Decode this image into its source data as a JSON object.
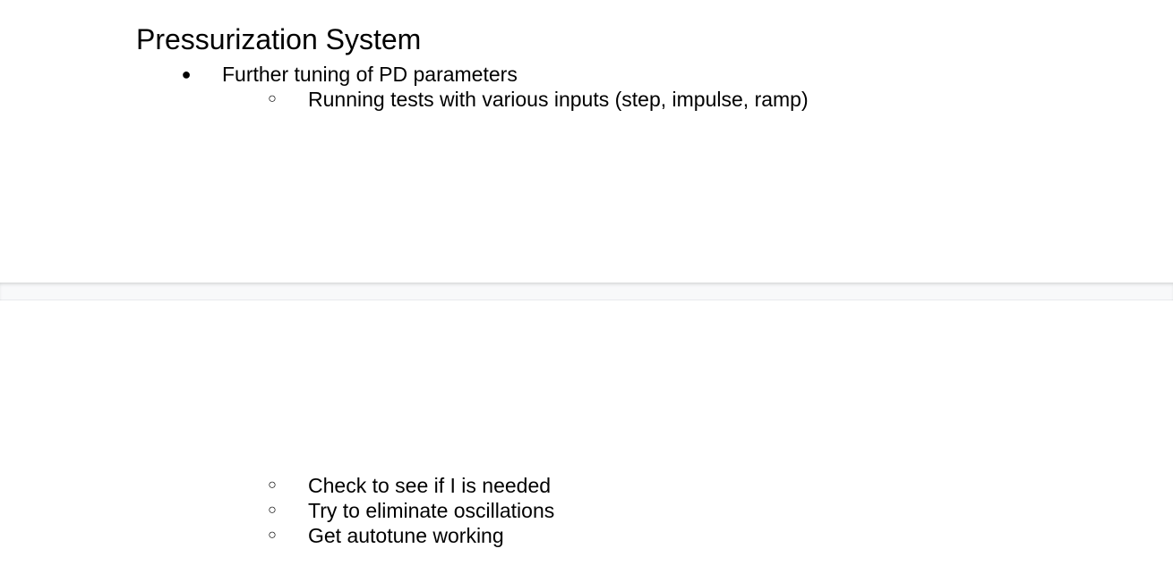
{
  "document": {
    "heading": "Pressurization System",
    "page1_items": [
      {
        "level": 1,
        "bullet": "●",
        "text": "Further tuning of PD parameters"
      },
      {
        "level": 2,
        "bullet": "○",
        "text": "Running tests with various inputs (step, impulse, ramp)"
      }
    ],
    "page2_items": [
      {
        "level": 2,
        "bullet": "○",
        "text": "Check to see if I is needed"
      },
      {
        "level": 2,
        "bullet": "○",
        "text": "Try to eliminate oscillations"
      },
      {
        "level": 2,
        "bullet": "○",
        "text": "Get autotune working"
      }
    ]
  }
}
